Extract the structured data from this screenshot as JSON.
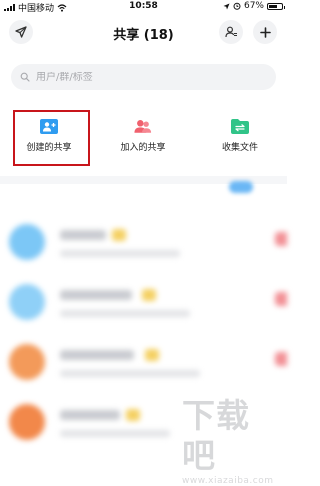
{
  "status_bar": {
    "carrier": "中国移动",
    "time": "10:58",
    "battery_percent": "67%",
    "battery_level": 0.67
  },
  "nav": {
    "title": "共享 (18)"
  },
  "search": {
    "placeholder": "用户/群/标签"
  },
  "quick_actions": [
    {
      "label": "创建的共享",
      "icon": "create-share-icon",
      "color": "#2f9cf0"
    },
    {
      "label": "加入的共享",
      "icon": "joined-share-icon",
      "color": "#f0616e"
    },
    {
      "label": "收集文件",
      "icon": "collect-files-icon",
      "color": "#31c488"
    }
  ],
  "colors": {
    "highlight": "#c8151b",
    "accent_blue": "#2f9cf0"
  },
  "watermark": {
    "big": "下载吧",
    "small": "www.xiazaiba.com"
  }
}
